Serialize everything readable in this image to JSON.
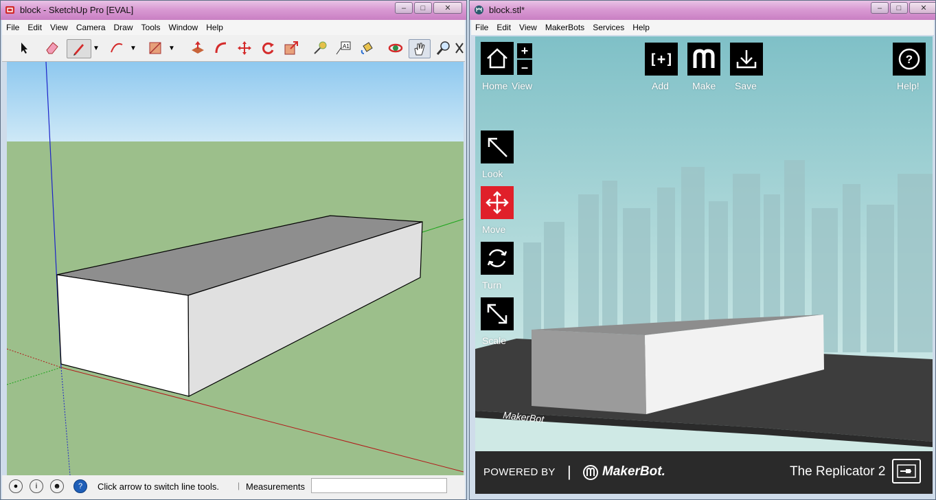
{
  "sketchup": {
    "title": "block - SketchUp Pro [EVAL]",
    "menu": [
      "File",
      "Edit",
      "View",
      "Camera",
      "Draw",
      "Tools",
      "Window",
      "Help"
    ],
    "status_hint": "Click arrow to switch line tools.",
    "measurements_label": "Measurements",
    "measurements_value": "",
    "colors": {
      "sky": "#a6d3ee",
      "ground": "#9bbf8a",
      "top_face": "#8e8e8e",
      "side_face": "#e0e0e0",
      "front_face": "#ffffff"
    }
  },
  "makerbot": {
    "title": "block.stl*",
    "menu": [
      "File",
      "Edit",
      "View",
      "MakerBots",
      "Services",
      "Help"
    ],
    "buttons": {
      "home": "Home",
      "view": "View",
      "add": "Add",
      "make": "Make",
      "save": "Save",
      "help": "Help!",
      "look": "Look",
      "move": "Move",
      "turn": "Turn",
      "scale": "Scale"
    },
    "footer": {
      "powered_by": "POWERED BY",
      "brand": "MakerBot.",
      "printer": "The Replicator 2"
    },
    "colors": {
      "accent": "#e0202a",
      "sky": "#9fd0d3",
      "platform": "#3c3c3c"
    }
  },
  "icons": [
    "sketchup-logo-icon",
    "select-arrow-icon",
    "eraser-icon",
    "pencil-icon",
    "arc-icon",
    "rectangle-icon",
    "push-pull-icon",
    "follow-me-icon",
    "move-icon",
    "rotate-icon",
    "scale-icon",
    "tape-measure-icon",
    "text-icon",
    "paint-bucket-icon",
    "orbit-icon",
    "pan-hand-icon",
    "zoom-icon",
    "geo-location-icon",
    "credits-icon",
    "account-icon",
    "help-icon",
    "home-icon",
    "plus-icon",
    "minus-icon",
    "add-icon",
    "make-icon",
    "save-icon",
    "help-circle-icon",
    "look-icon",
    "move-arrows-icon",
    "turn-icon",
    "scale-arrows-icon",
    "replicator-icon"
  ]
}
